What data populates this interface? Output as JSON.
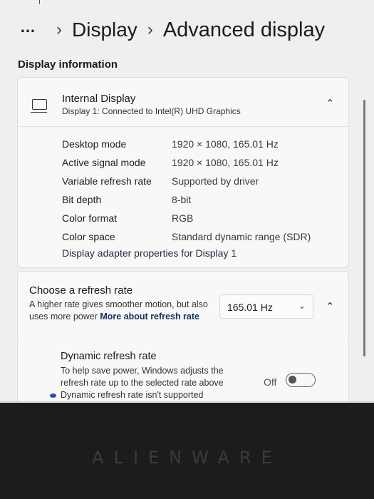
{
  "breadcrumb": {
    "overflow": "…",
    "separator": "›",
    "parent": "Display",
    "current": "Advanced display"
  },
  "section_heading": "Display information",
  "display_card": {
    "icon": "monitor-icon",
    "title": "Internal Display",
    "subtitle": "Display 1: Connected to Intel(R) UHD Graphics",
    "chevron": "⌃",
    "rows": [
      {
        "label": "Desktop mode",
        "value": "1920 × 1080, 165.01 Hz"
      },
      {
        "label": "Active signal mode",
        "value": "1920 × 1080, 165.01 Hz"
      },
      {
        "label": "Variable refresh rate",
        "value": "Supported by driver"
      },
      {
        "label": "Bit depth",
        "value": "8-bit"
      },
      {
        "label": "Color format",
        "value": "RGB"
      },
      {
        "label": "Color space",
        "value": "Standard dynamic range (SDR)"
      }
    ],
    "adapter_link": "Display adapter properties for Display 1"
  },
  "refresh_card": {
    "title": "Choose a refresh rate",
    "desc_text": "A higher rate gives smoother motion, but also uses more power",
    "desc_link": "More about refresh rate",
    "selected_rate": "165.01 Hz",
    "dropdown_glyph": "⌄",
    "chevron": "⌃"
  },
  "dynamic_card": {
    "title": "Dynamic refresh rate",
    "desc": "To help save power, Windows adjusts the refresh rate up to the selected rate above",
    "toggle_state": "Off",
    "notice": "Dynamic refresh rate isn't supported"
  },
  "taskbar": {
    "icons": [
      "windows-start-icon",
      "search-icon",
      "task-view-icon",
      "copilot-icon",
      "file-explorer-icon",
      "edge-icon",
      "store-icon",
      "tool-icon",
      "alienware-icon",
      "settings-icon"
    ],
    "active": "settings-icon"
  },
  "bezel_brand": "ALIENWARE",
  "colors": {
    "window_bg": "#efefef",
    "card_bg": "#f8f8f8",
    "accent": "#1560c0",
    "link": "#15315a"
  }
}
